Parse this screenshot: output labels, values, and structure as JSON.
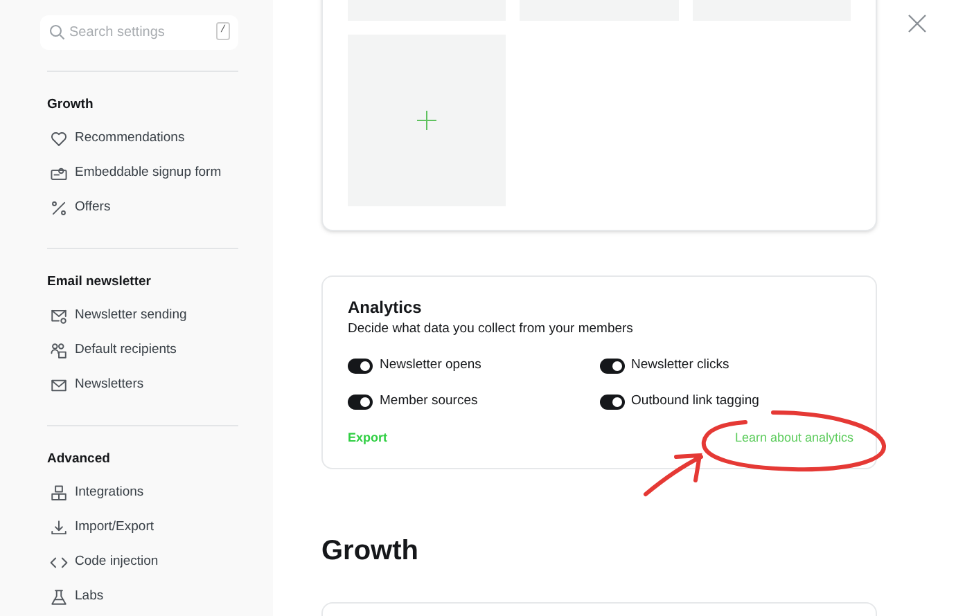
{
  "sidebar": {
    "search": {
      "placeholder": "Search settings",
      "shortcut": "/"
    },
    "sections": [
      {
        "title": "Growth",
        "items": [
          {
            "label": "Recommendations"
          },
          {
            "label": "Embeddable signup form"
          },
          {
            "label": "Offers"
          }
        ]
      },
      {
        "title": "Email newsletter",
        "items": [
          {
            "label": "Newsletter sending"
          },
          {
            "label": "Default recipients"
          },
          {
            "label": "Newsletters"
          }
        ]
      },
      {
        "title": "Advanced",
        "items": [
          {
            "label": "Integrations"
          },
          {
            "label": "Import/Export"
          },
          {
            "label": "Code injection"
          },
          {
            "label": "Labs"
          }
        ]
      }
    ]
  },
  "gallery": {
    "tiles": [
      {
        "kind": "placeholder"
      },
      {
        "kind": "placeholder"
      },
      {
        "kind": "placeholder"
      },
      {
        "kind": "add"
      }
    ]
  },
  "analytics": {
    "title": "Analytics",
    "description": "Decide what data you collect from your members",
    "toggles": [
      {
        "label": "Newsletter opens",
        "on": true
      },
      {
        "label": "Newsletter clicks",
        "on": true
      },
      {
        "label": "Member sources",
        "on": true
      },
      {
        "label": "Outbound link tagging",
        "on": true
      }
    ],
    "export_link": "Export",
    "learn_link": "Learn about analytics"
  },
  "next_section": {
    "title": "Growth"
  },
  "annotation": {
    "kind": "circle-and-arrow"
  }
}
